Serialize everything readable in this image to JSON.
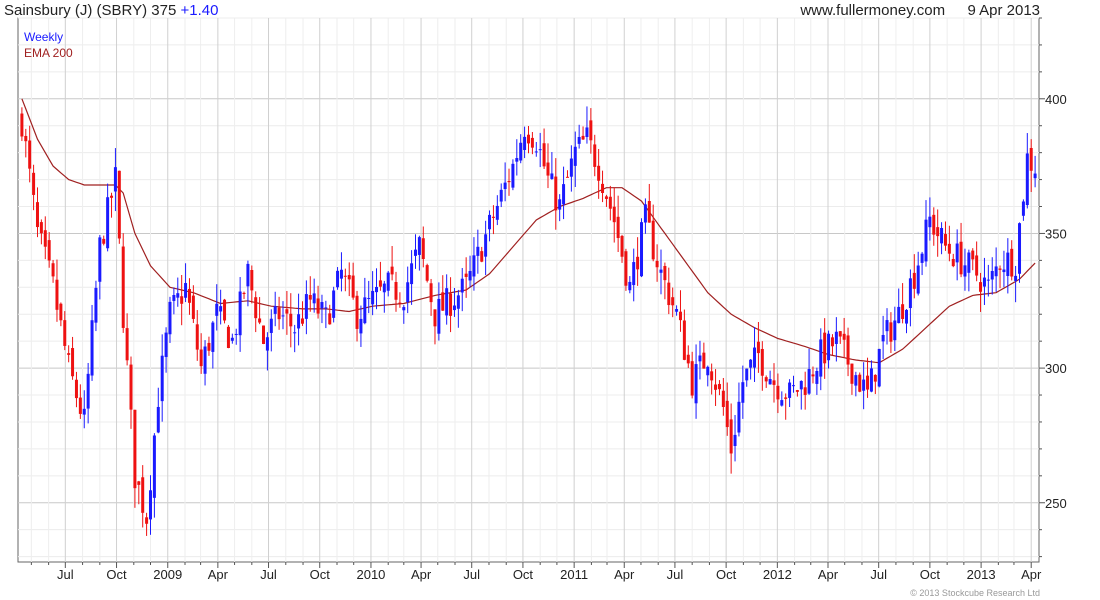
{
  "header": {
    "title": "Sainsbury (J) (SBRY) 375",
    "change": "+1.40",
    "site": "www.fullermoney.com",
    "date": "9 Apr 2013"
  },
  "legend": {
    "series": "Weekly",
    "ema": "EMA 200"
  },
  "footer": {
    "copyright": "© 2013 Stockcube Research Ltd"
  },
  "chart_data": {
    "type": "candlestick",
    "period": "weekly",
    "y_axis_side": "right",
    "ylim": [
      228,
      430
    ],
    "y_ticks": [
      250,
      300,
      350,
      400
    ],
    "x_ticks": [
      "Jul",
      "Oct",
      "2009",
      "Apr",
      "Jul",
      "Oct",
      "2010",
      "Apr",
      "Jul",
      "Oct",
      "2011",
      "Apr",
      "Jul",
      "Oct",
      "2012",
      "Apr",
      "Jul",
      "Oct",
      "2013",
      "Apr"
    ],
    "colors": {
      "up": "#1a1aff",
      "down": "#ee1111",
      "ema": "#a02020",
      "grid": "#d4d4d4"
    },
    "close_anchors": [
      [
        "2008-04-14",
        392
      ],
      [
        "2008-05-12",
        350
      ],
      [
        "2008-06-09",
        330
      ],
      [
        "2008-07-07",
        300
      ],
      [
        "2008-08-04",
        280
      ],
      [
        "2008-09-01",
        345
      ],
      [
        "2008-09-29",
        370
      ],
      [
        "2008-10-13",
        320
      ],
      [
        "2008-11-03",
        260
      ],
      [
        "2008-11-24",
        245
      ],
      [
        "2008-12-15",
        290
      ],
      [
        "2009-01-05",
        320
      ],
      [
        "2009-02-02",
        330
      ],
      [
        "2009-03-02",
        300
      ],
      [
        "2009-03-30",
        320
      ],
      [
        "2009-04-27",
        310
      ],
      [
        "2009-05-25",
        335
      ],
      [
        "2009-06-22",
        310
      ],
      [
        "2009-07-20",
        320
      ],
      [
        "2009-08-17",
        315
      ],
      [
        "2009-09-14",
        325
      ],
      [
        "2009-10-12",
        318
      ],
      [
        "2009-11-09",
        335
      ],
      [
        "2009-12-07",
        320
      ],
      [
        "2010-01-04",
        325
      ],
      [
        "2010-02-01",
        330
      ],
      [
        "2010-03-01",
        328
      ],
      [
        "2010-03-29",
        345
      ],
      [
        "2010-04-26",
        320
      ],
      [
        "2010-05-24",
        325
      ],
      [
        "2010-06-21",
        330
      ],
      [
        "2010-07-19",
        345
      ],
      [
        "2010-08-16",
        360
      ],
      [
        "2010-09-13",
        375
      ],
      [
        "2010-10-04",
        390
      ],
      [
        "2010-10-25",
        385
      ],
      [
        "2010-11-15",
        370
      ],
      [
        "2010-12-06",
        360
      ],
      [
        "2011-01-03",
        380
      ],
      [
        "2011-01-24",
        385
      ],
      [
        "2011-02-14",
        375
      ],
      [
        "2011-03-14",
        355
      ],
      [
        "2011-04-11",
        330
      ],
      [
        "2011-05-09",
        355
      ],
      [
        "2011-06-06",
        335
      ],
      [
        "2011-07-04",
        320
      ],
      [
        "2011-08-01",
        295
      ],
      [
        "2011-08-29",
        305
      ],
      [
        "2011-09-26",
        285
      ],
      [
        "2011-10-10",
        270
      ],
      [
        "2011-10-31",
        295
      ],
      [
        "2011-11-28",
        305
      ],
      [
        "2011-12-26",
        295
      ],
      [
        "2012-01-23",
        290
      ],
      [
        "2012-02-20",
        295
      ],
      [
        "2012-03-19",
        305
      ],
      [
        "2012-04-16",
        310
      ],
      [
        "2012-05-14",
        300
      ],
      [
        "2012-06-11",
        290
      ],
      [
        "2012-07-09",
        310
      ],
      [
        "2012-08-06",
        320
      ],
      [
        "2012-09-03",
        335
      ],
      [
        "2012-10-01",
        355
      ],
      [
        "2012-10-29",
        345
      ],
      [
        "2012-11-26",
        340
      ],
      [
        "2012-12-24",
        335
      ],
      [
        "2013-01-14",
        330
      ],
      [
        "2013-02-04",
        340
      ],
      [
        "2013-03-04",
        340
      ],
      [
        "2013-03-25",
        378
      ],
      [
        "2013-04-08",
        375
      ]
    ],
    "ema_anchors": [
      [
        "2008-04-14",
        400
      ],
      [
        "2008-05-12",
        385
      ],
      [
        "2008-06-09",
        375
      ],
      [
        "2008-07-07",
        370
      ],
      [
        "2008-08-04",
        368
      ],
      [
        "2008-09-01",
        368
      ],
      [
        "2008-09-29",
        368
      ],
      [
        "2008-10-13",
        365
      ],
      [
        "2008-11-03",
        350
      ],
      [
        "2008-12-01",
        338
      ],
      [
        "2009-01-05",
        330
      ],
      [
        "2009-02-16",
        328
      ],
      [
        "2009-04-06",
        324
      ],
      [
        "2009-05-25",
        325
      ],
      [
        "2009-07-06",
        323
      ],
      [
        "2009-08-31",
        322
      ],
      [
        "2009-10-12",
        322
      ],
      [
        "2009-11-23",
        321
      ],
      [
        "2010-01-04",
        323
      ],
      [
        "2010-03-01",
        324
      ],
      [
        "2010-04-26",
        327
      ],
      [
        "2010-06-21",
        329
      ],
      [
        "2010-08-02",
        335
      ],
      [
        "2010-09-13",
        345
      ],
      [
        "2010-10-25",
        355
      ],
      [
        "2010-12-06",
        360
      ],
      [
        "2011-01-17",
        363
      ],
      [
        "2011-02-28",
        367
      ],
      [
        "2011-03-28",
        367
      ],
      [
        "2011-05-02",
        362
      ],
      [
        "2011-06-06",
        352
      ],
      [
        "2011-07-18",
        340
      ],
      [
        "2011-08-29",
        328
      ],
      [
        "2011-10-10",
        320
      ],
      [
        "2011-11-21",
        315
      ],
      [
        "2012-01-02",
        311
      ],
      [
        "2012-02-20",
        308
      ],
      [
        "2012-04-02",
        305
      ],
      [
        "2012-05-21",
        303
      ],
      [
        "2012-07-02",
        302
      ],
      [
        "2012-08-13",
        307
      ],
      [
        "2012-09-24",
        315
      ],
      [
        "2012-11-05",
        323
      ],
      [
        "2012-12-17",
        327
      ],
      [
        "2013-01-28",
        328
      ],
      [
        "2013-03-11",
        333
      ],
      [
        "2013-04-08",
        339
      ]
    ]
  }
}
